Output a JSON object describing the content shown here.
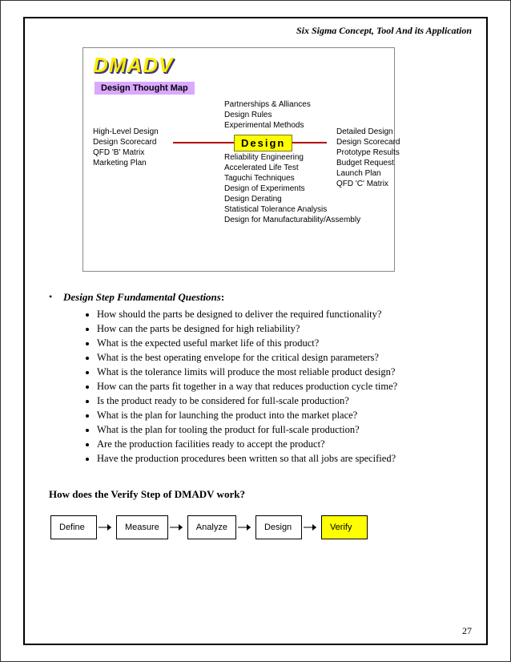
{
  "header": {
    "title": "Six Sigma Concept, Tool And its Application"
  },
  "diagram": {
    "dmadv": "DMADV",
    "thought_map": "Design Thought Map",
    "design_label": "Design",
    "left_col": [
      "High-Level Design",
      "Design Scorecard",
      "QFD 'B' Matrix",
      "Marketing Plan"
    ],
    "top_col": [
      "Partnerships & Alliances",
      "Design Rules",
      "Experimental Methods"
    ],
    "bottom_col": [
      "Reliability Engineering",
      "Accelerated Life Test",
      "Taguchi Techniques",
      "Design of Experiments",
      "Design Derating",
      "Statistical Tolerance Analysis",
      "Design for Manufacturability/Assembly"
    ],
    "right_col": [
      "Detailed Design",
      "Design Scorecard",
      "Prototype Results",
      "Budget Request",
      "Launch Plan",
      "QFD 'C' Matrix"
    ]
  },
  "questions": {
    "title": "Design Step Fundamental Questions",
    "items": [
      "How should the parts be designed to deliver the required functionality?",
      "How can the parts be designed for high reliability?",
      "What is the expected useful market life of this product?",
      "What is the best operating envelope for the critical design parameters?",
      "What is the tolerance limits will produce the most reliable product design?",
      "How can the parts fit together in a way that reduces production cycle time?",
      "Is the product ready to be considered for full-scale production?",
      "What is the plan for launching the product into the market place?",
      "What is the plan for tooling the product for full-scale production?",
      "Are the production facilities ready to accept the product?",
      "Have the production procedures been written so that all jobs are specified?"
    ]
  },
  "verify": {
    "title": "How does the Verify Step of DMADV work?",
    "steps": [
      "Define",
      "Measure",
      "Analyze",
      "Design",
      "Verify"
    ]
  },
  "page_number": "27"
}
